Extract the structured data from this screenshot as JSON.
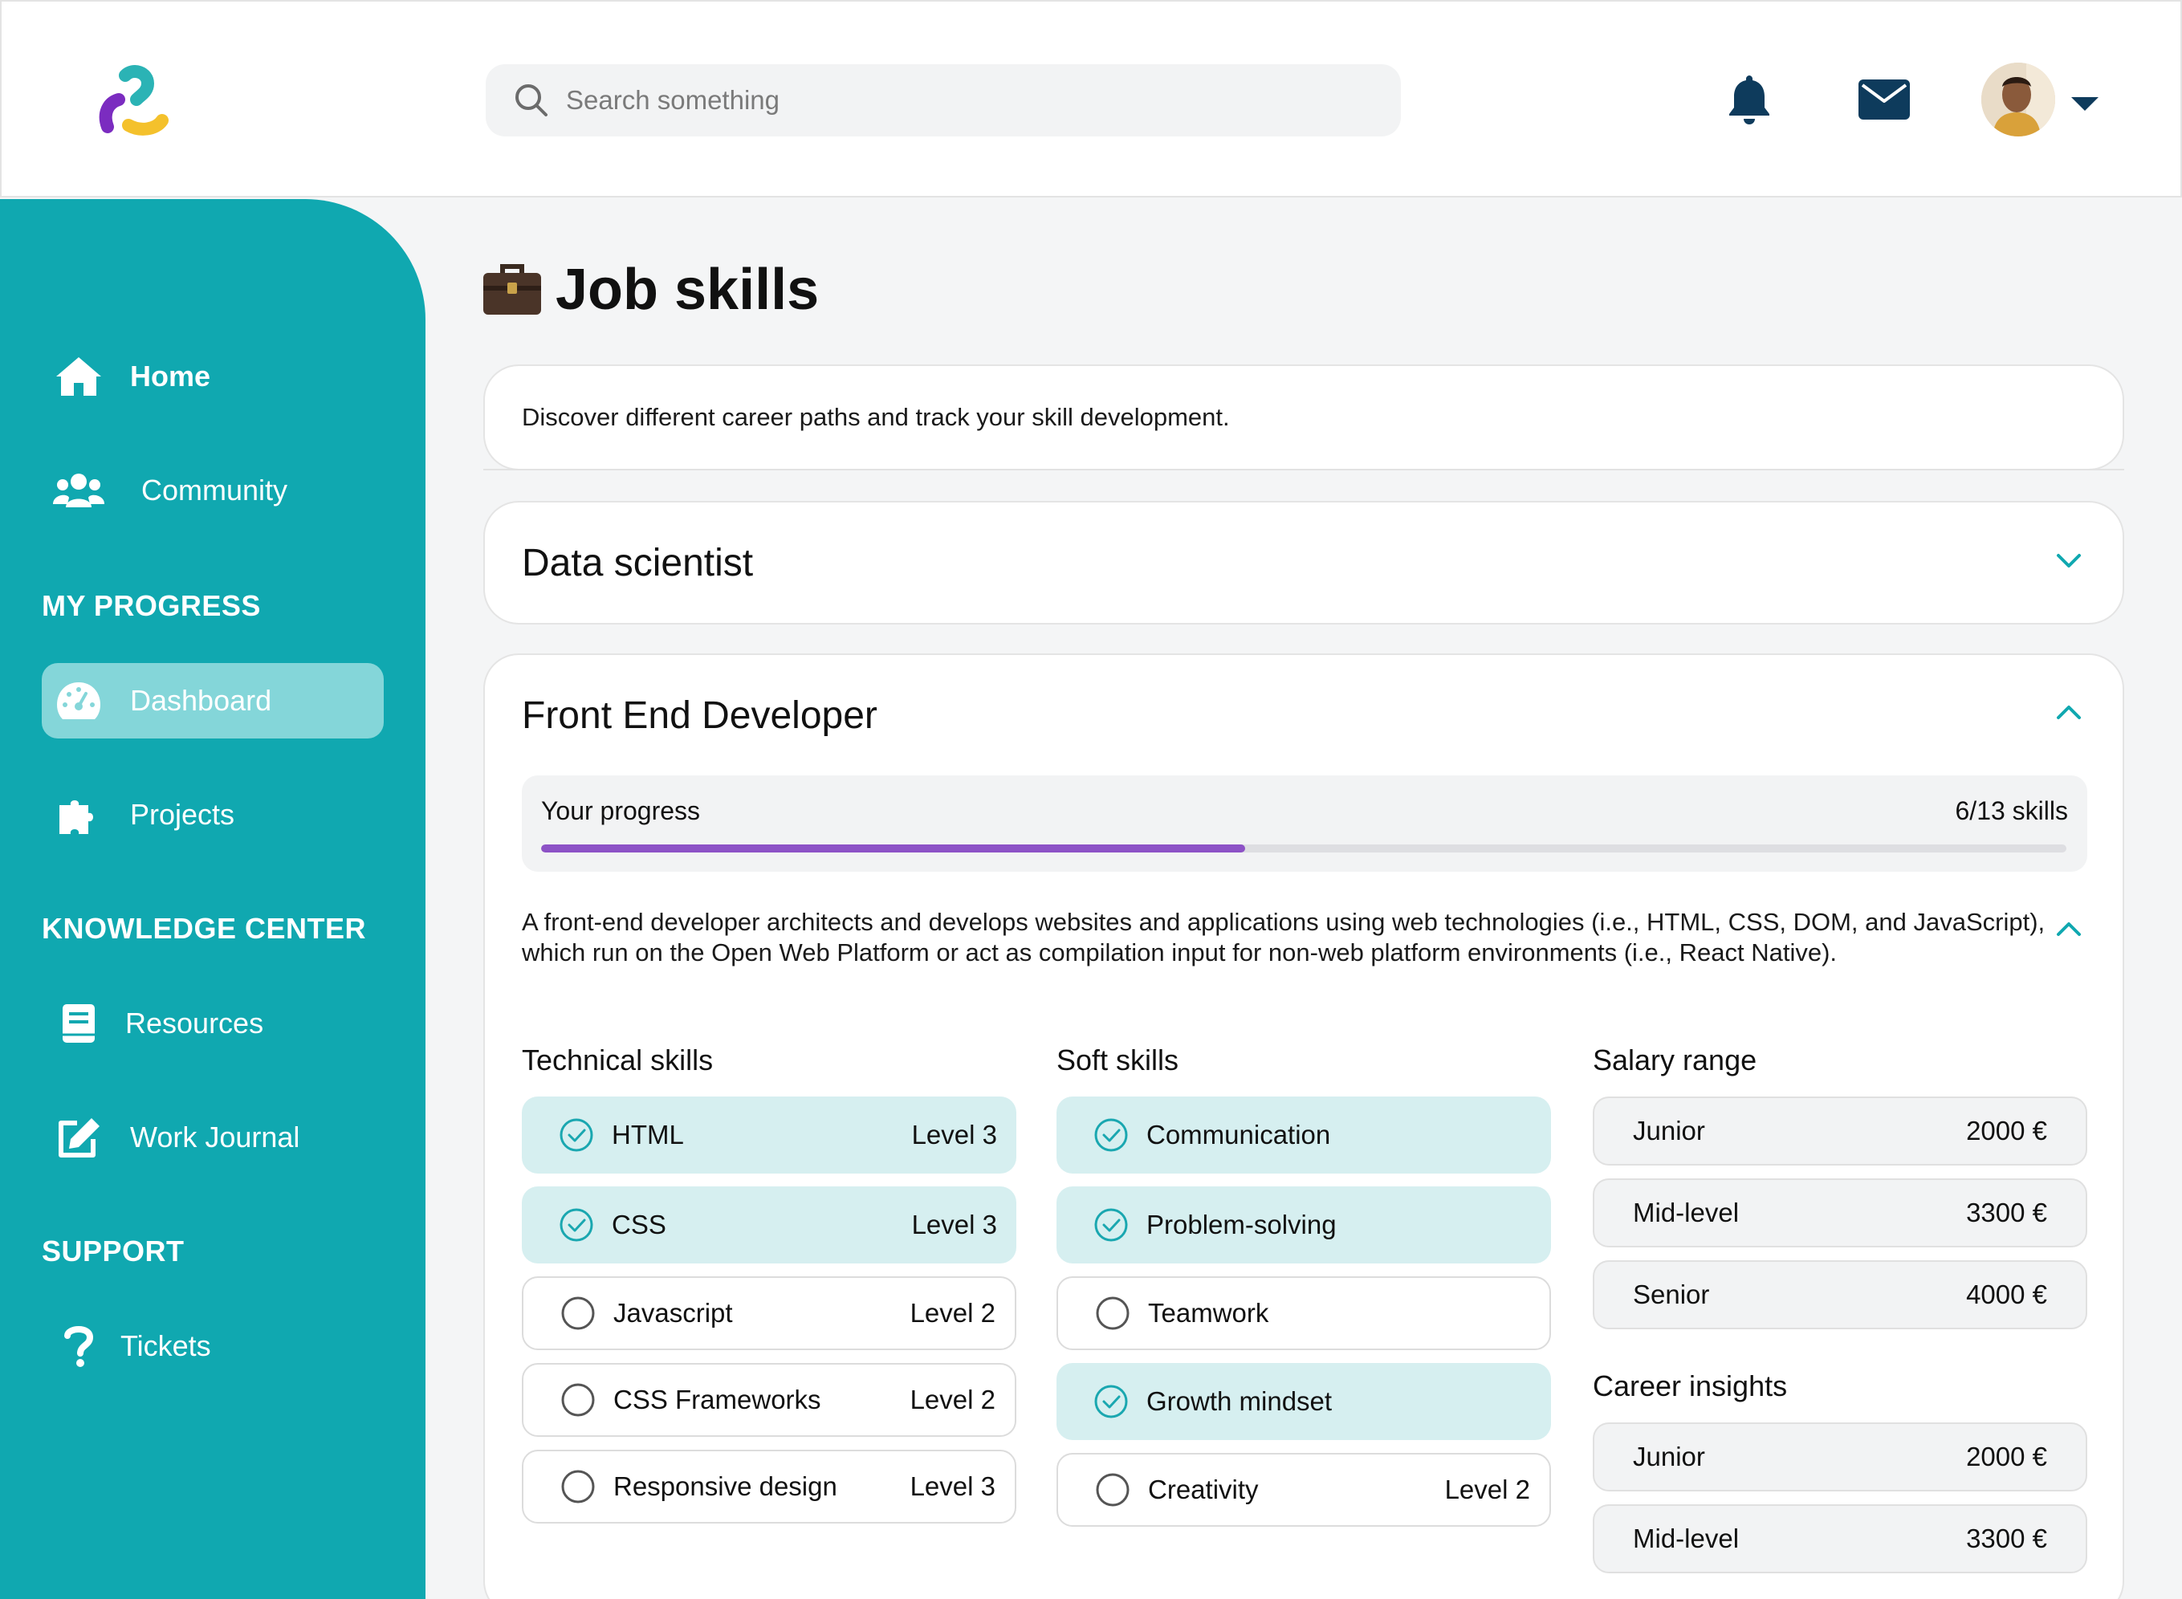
{
  "header": {
    "search_placeholder": "Search something"
  },
  "sidebar": {
    "items": [
      {
        "label": "Home"
      },
      {
        "label": "Community"
      },
      {
        "label": "Dashboard"
      },
      {
        "label": "Projects"
      },
      {
        "label": "Resources"
      },
      {
        "label": "Work Journal"
      },
      {
        "label": "Tickets"
      }
    ],
    "sections": [
      "MY PROGRESS",
      "KNOWLEDGE CENTER",
      "SUPPORT"
    ]
  },
  "main": {
    "title": "Job skills",
    "intro": "Discover different career paths and track your skill development.",
    "careers": [
      {
        "title": "Data scientist",
        "expanded": false
      },
      {
        "title": "Front End Developer",
        "expanded": true,
        "progress": {
          "label": "Your progress",
          "count": "6/13 skills",
          "fraction": 0.4615
        },
        "description": "A front-end developer architects and develops websites and applications using web technologies (i.e., HTML, CSS, DOM, and JavaScript), which run on the Open Web Platform or act as compilation input for non-web platform environments (i.e., React Native).",
        "technical_title": "Technical skills",
        "technical": [
          {
            "name": "HTML",
            "level": "Level 3",
            "done": true
          },
          {
            "name": "CSS",
            "level": "Level 3",
            "done": true
          },
          {
            "name": "Javascript",
            "level": "Level 2",
            "done": false
          },
          {
            "name": "CSS Frameworks",
            "level": "Level 2",
            "done": false
          },
          {
            "name": "Responsive design",
            "level": "Level 3",
            "done": false
          }
        ],
        "soft_title": "Soft skills",
        "soft": [
          {
            "name": "Communication",
            "level": "",
            "done": true
          },
          {
            "name": "Problem-solving",
            "level": "",
            "done": true
          },
          {
            "name": "Teamwork",
            "level": "",
            "done": false
          },
          {
            "name": "Growth mindset",
            "level": "",
            "done": true
          },
          {
            "name": "Creativity",
            "level": "Level 2",
            "done": false
          }
        ],
        "salary_title": "Salary range",
        "salary": [
          {
            "role": "Junior",
            "amount": "2000 €"
          },
          {
            "role": "Mid-level",
            "amount": "3300 €"
          },
          {
            "role": "Senior",
            "amount": "4000 €"
          }
        ],
        "insights_title": "Career insights",
        "insights": [
          {
            "role": "Junior",
            "amount": "2000 €"
          },
          {
            "role": "Mid-level",
            "amount": "3300 €"
          }
        ]
      }
    ]
  },
  "colors": {
    "sidebar": "#10a8b0",
    "active_item": "#84d6d9",
    "skill_done_bg": "#d6eff0",
    "check": "#1aa7b0",
    "progress": "#8d52c6",
    "icon_navy": "#0e3b5c",
    "chevron": "#10a8b0"
  }
}
